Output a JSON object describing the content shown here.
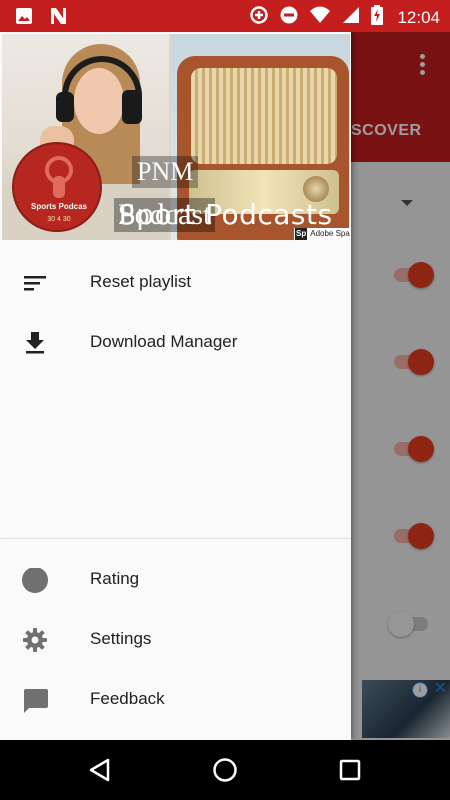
{
  "status_bar": {
    "time": "12:04",
    "left_icons": [
      "image-icon",
      "n-notification-icon"
    ],
    "right_icons": [
      "data-saver-icon",
      "do-not-disturb-icon",
      "wifi-icon",
      "signal-icon",
      "battery-charging-icon"
    ]
  },
  "drawer": {
    "header": {
      "badge_title": "Sports Podcas",
      "badge_subtitle": "30 4 30",
      "overlay_line1": "PNM",
      "overlay_line2_back": "Podcast",
      "overlay_line2_front": "Sport Podcasts",
      "watermark_logo": "Sp",
      "watermark_text": "Adobe Spark"
    },
    "items": [
      {
        "label": "Reset playlist",
        "icon": "sort-icon"
      },
      {
        "label": "Download Manager",
        "icon": "download-icon"
      }
    ],
    "footer_items": [
      {
        "label": "Rating",
        "icon": "circle-icon"
      },
      {
        "label": "Settings",
        "icon": "gear-icon"
      },
      {
        "label": "Feedback",
        "icon": "feedback-icon"
      }
    ]
  },
  "background": {
    "tab_label": "SCOVER",
    "toggles": [
      {
        "state": "on"
      },
      {
        "state": "on"
      },
      {
        "state": "on"
      },
      {
        "state": "on"
      },
      {
        "state": "off"
      }
    ],
    "ad_info": "i",
    "ad_close": "✕"
  },
  "colors": {
    "primary": "#c41e1e",
    "accent": "#e53c1e",
    "nav_bar": "#000000",
    "drawer_text": "#212121"
  }
}
